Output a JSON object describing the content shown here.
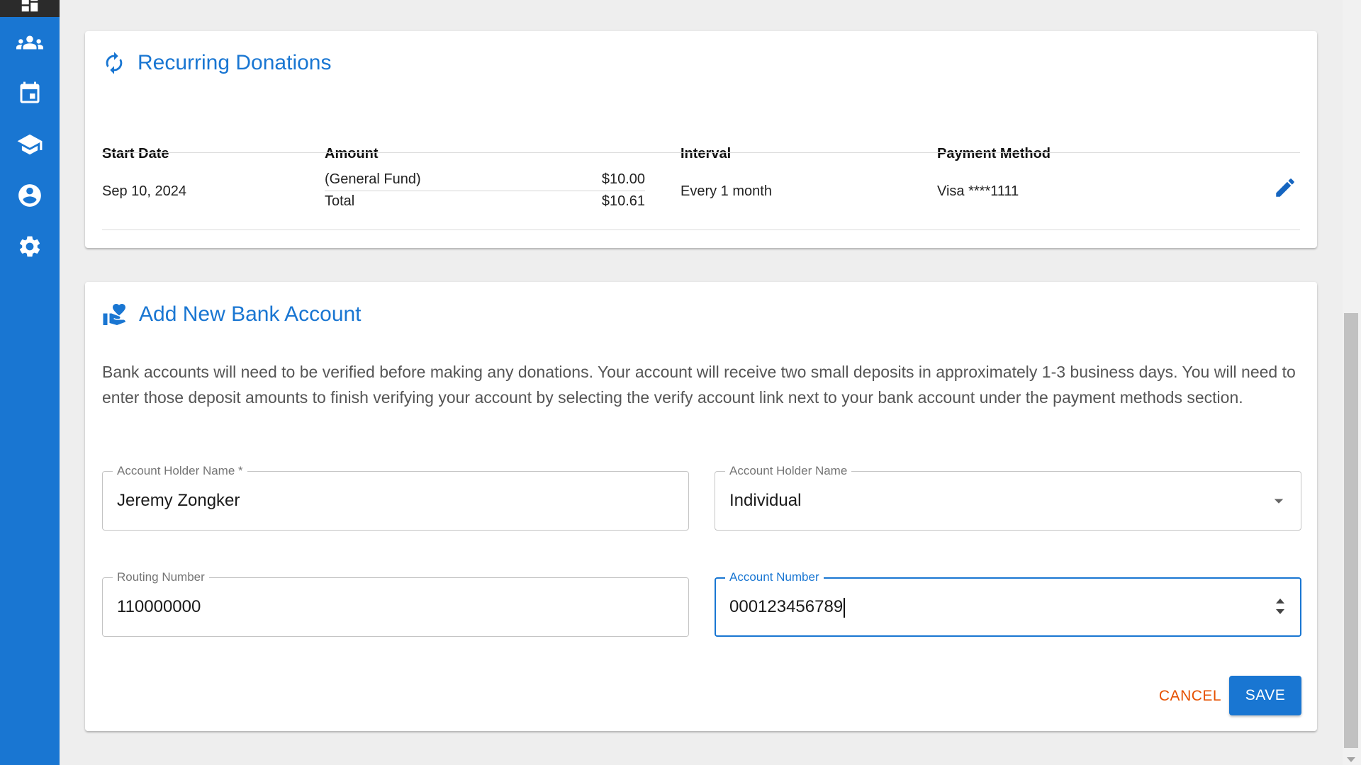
{
  "sidebar": {
    "items": [
      {
        "icon": "people-icon"
      },
      {
        "icon": "calendar-icon"
      },
      {
        "icon": "school-icon"
      },
      {
        "icon": "account-circle-icon"
      },
      {
        "icon": "gear-icon"
      }
    ]
  },
  "recurring": {
    "title": "Recurring Donations",
    "headers": [
      "Start Date",
      "Amount",
      "Interval",
      "Payment Method"
    ],
    "rows": [
      {
        "start_date": "Sep 10, 2024",
        "fund_label": "(General Fund)",
        "fund_amount": "$10.00",
        "total_label": "Total",
        "total_amount": "$10.61",
        "interval": "Every 1 month",
        "payment_method": "Visa ****1111"
      }
    ]
  },
  "bank": {
    "title": "Add New Bank Account",
    "description": "Bank accounts will need to be verified before making any donations. Your account will receive two small deposits in approximately 1-3 business days. You will need to enter those deposit amounts to finish verifying your account by selecting the verify account link next to your bank account under the payment methods section.",
    "fields": {
      "holder_name": {
        "label": "Account Holder Name *",
        "value": "Jeremy Zongker"
      },
      "holder_type": {
        "label": "Account Holder Name",
        "value": "Individual"
      },
      "routing": {
        "label": "Routing Number",
        "value": "110000000"
      },
      "account": {
        "label": "Account Number",
        "value": "000123456789"
      }
    },
    "cancel_label": "CANCEL",
    "save_label": "SAVE"
  },
  "colors": {
    "primary": "#1976d2",
    "cancel": "#e65100",
    "background": "#eeeeee"
  }
}
